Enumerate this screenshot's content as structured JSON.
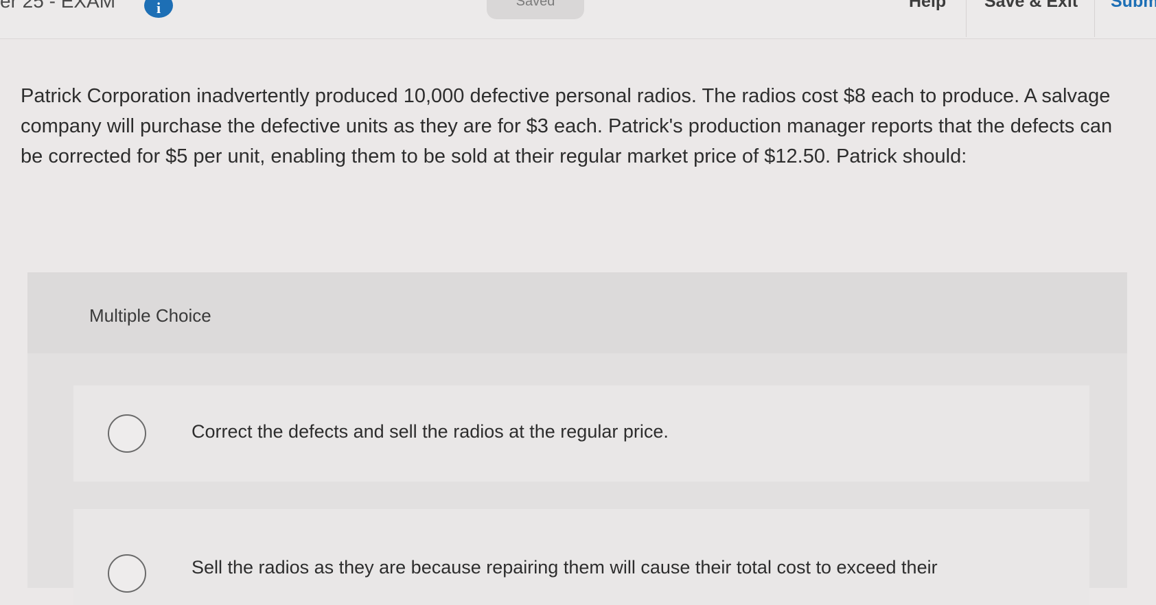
{
  "header": {
    "exam_title": "er 25 - EXAM",
    "info_icon_glyph": "i",
    "status": "Saved",
    "nav": {
      "help": "Help",
      "save_exit": "Save & Exit",
      "submit": "Subm"
    },
    "accent_color": "#1d6fb5"
  },
  "question": {
    "text": "Patrick Corporation inadvertently produced 10,000 defective personal radios. The radios cost $8 each to produce. A salvage company will purchase the defective units as they are for $3 each. Patrick's production manager reports that the defects can be corrected for $5 per unit, enabling them to be sold at their regular market price of $12.50. Patrick should:"
  },
  "multiple_choice": {
    "label": "Multiple Choice",
    "options": [
      {
        "text": "Correct the defects and sell the radios at the regular price."
      },
      {
        "text": "Sell the radios as they are because repairing them will cause their total cost to exceed their"
      }
    ]
  },
  "icons": {
    "info": "info-icon",
    "radio": "radio-button-icon"
  }
}
